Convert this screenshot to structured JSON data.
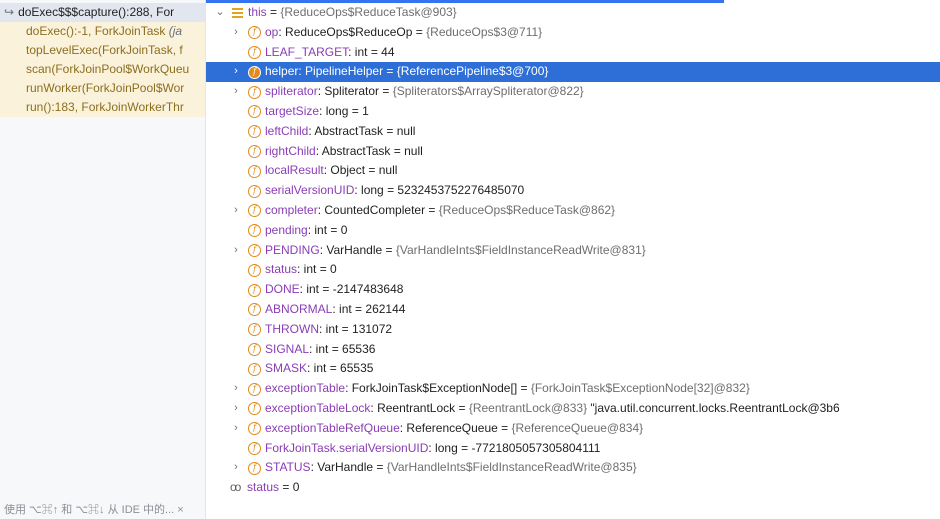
{
  "frames": {
    "items": [
      {
        "text": "doExec$$$capture():288, For",
        "italic": "",
        "first": true
      },
      {
        "text": "doExec():-1, ForkJoinTask ",
        "italic": "(ja",
        "first": false
      },
      {
        "text": "topLevelExec(ForkJoinTask, f",
        "italic": "",
        "first": false
      },
      {
        "text": "scan(ForkJoinPool$WorkQueu",
        "italic": "",
        "first": false
      },
      {
        "text": "runWorker(ForkJoinPool$Wor",
        "italic": "",
        "first": false
      },
      {
        "text": "run():183, ForkJoinWorkerThr",
        "italic": "",
        "first": false
      }
    ],
    "hint": "使用 ⌥⌘↑ 和 ⌥⌘↓ 从 IDE 中的... ×"
  },
  "variables": {
    "root": {
      "name": "this",
      "eq": " = ",
      "value": "{ReduceOps$ReduceTask@903}"
    },
    "fields": [
      {
        "expand": true,
        "name": "op",
        "type": ": ReduceOps$ReduceOp",
        "eq": " = ",
        "value": "{ReduceOps$3@711}",
        "kw": true,
        "selected": false
      },
      {
        "expand": false,
        "name": "LEAF_TARGET",
        "type": ": int",
        "eq": " = ",
        "value": "44",
        "kw": true,
        "valstr": true,
        "selected": false
      },
      {
        "expand": true,
        "name": "helper",
        "type": ": PipelineHelper",
        "eq": " = ",
        "value": "{ReferencePipeline$3@700}",
        "kw": true,
        "selected": true
      },
      {
        "expand": true,
        "name": "spliterator",
        "type": ": Spliterator",
        "eq": " = ",
        "value": "{Spliterators$ArraySpliterator@822}",
        "kw": true,
        "selected": false
      },
      {
        "expand": false,
        "name": "targetSize",
        "type": ": long",
        "eq": " = ",
        "value": "1",
        "kw": true,
        "valstr": true,
        "selected": false
      },
      {
        "expand": false,
        "name": "leftChild",
        "type": ": AbstractTask",
        "eq": " = ",
        "value": "null",
        "kw": true,
        "valstr": true,
        "selected": false
      },
      {
        "expand": false,
        "name": "rightChild",
        "type": ": AbstractTask",
        "eq": " = ",
        "value": "null",
        "kw": true,
        "valstr": true,
        "selected": false
      },
      {
        "expand": false,
        "name": "localResult",
        "type": ": Object",
        "eq": " = ",
        "value": "null",
        "kw": true,
        "valstr": true,
        "selected": false
      },
      {
        "expand": false,
        "name": "serialVersionUID",
        "type": ": long",
        "eq": " = ",
        "value": "5232453752276485070",
        "kw": true,
        "valstr": true,
        "selected": false
      },
      {
        "expand": true,
        "name": "completer",
        "type": ": CountedCompleter",
        "eq": " = ",
        "value": "{ReduceOps$ReduceTask@862}",
        "kw": true,
        "selected": false
      },
      {
        "expand": false,
        "name": "pending",
        "type": ": int",
        "eq": " = ",
        "value": "0",
        "kw": true,
        "valstr": true,
        "selected": false
      },
      {
        "expand": true,
        "name": "PENDING",
        "type": ": VarHandle",
        "eq": " = ",
        "value": "{VarHandleInts$FieldInstanceReadWrite@831}",
        "kw": true,
        "selected": false
      },
      {
        "expand": false,
        "name": "status",
        "type": ": int",
        "eq": " = ",
        "value": "0",
        "kw": true,
        "valstr": true,
        "selected": false
      },
      {
        "expand": false,
        "name": "DONE",
        "type": ": int",
        "eq": " = ",
        "value": "-2147483648",
        "kw": true,
        "valstr": true,
        "selected": false
      },
      {
        "expand": false,
        "name": "ABNORMAL",
        "type": ": int",
        "eq": " = ",
        "value": "262144",
        "kw": true,
        "valstr": true,
        "selected": false
      },
      {
        "expand": false,
        "name": "THROWN",
        "type": ": int",
        "eq": " = ",
        "value": "131072",
        "kw": true,
        "valstr": true,
        "selected": false
      },
      {
        "expand": false,
        "name": "SIGNAL",
        "type": ": int",
        "eq": " = ",
        "value": "65536",
        "kw": true,
        "valstr": true,
        "selected": false
      },
      {
        "expand": false,
        "name": "SMASK",
        "type": ": int",
        "eq": " = ",
        "value": "65535",
        "kw": true,
        "valstr": true,
        "selected": false
      },
      {
        "expand": true,
        "name": "exceptionTable",
        "type": ": ForkJoinTask$ExceptionNode[]",
        "eq": " = ",
        "value": "{ForkJoinTask$ExceptionNode[32]@832}",
        "kw": true,
        "selected": false
      },
      {
        "expand": true,
        "name": "exceptionTableLock",
        "type": ": ReentrantLock",
        "eq": " = ",
        "value": "{ReentrantLock@833}",
        "extra": " \"java.util.concurrent.locks.ReentrantLock@3b6",
        "kw": true,
        "selected": false
      },
      {
        "expand": true,
        "name": "exceptionTableRefQueue",
        "type": ": ReferenceQueue",
        "eq": " = ",
        "value": "{ReferenceQueue@834}",
        "kw": true,
        "selected": false
      },
      {
        "expand": false,
        "name": "ForkJoinTask.serialVersionUID",
        "type": ": long",
        "eq": " = ",
        "value": "-7721805057305804111",
        "kw": true,
        "valstr": true,
        "selected": false
      },
      {
        "expand": true,
        "name": "STATUS",
        "type": ": VarHandle",
        "eq": " = ",
        "value": "{VarHandleInts$FieldInstanceReadWrite@835}",
        "kw": true,
        "selected": false
      }
    ],
    "watch": {
      "name": "status",
      "eq": " = ",
      "value": "0"
    }
  },
  "icons": {
    "field": "f",
    "chevron_right": "›",
    "chevron_down": "⌄",
    "return": "↪",
    "watch": "oo"
  },
  "colors": {
    "accent": "#3574f0",
    "selection": "#2d6fd6",
    "field_icon": "#e28a1a",
    "keyword": "#8a3db6",
    "frame_bg": "#fbf2dc",
    "frame_text": "#8b6f1e"
  }
}
